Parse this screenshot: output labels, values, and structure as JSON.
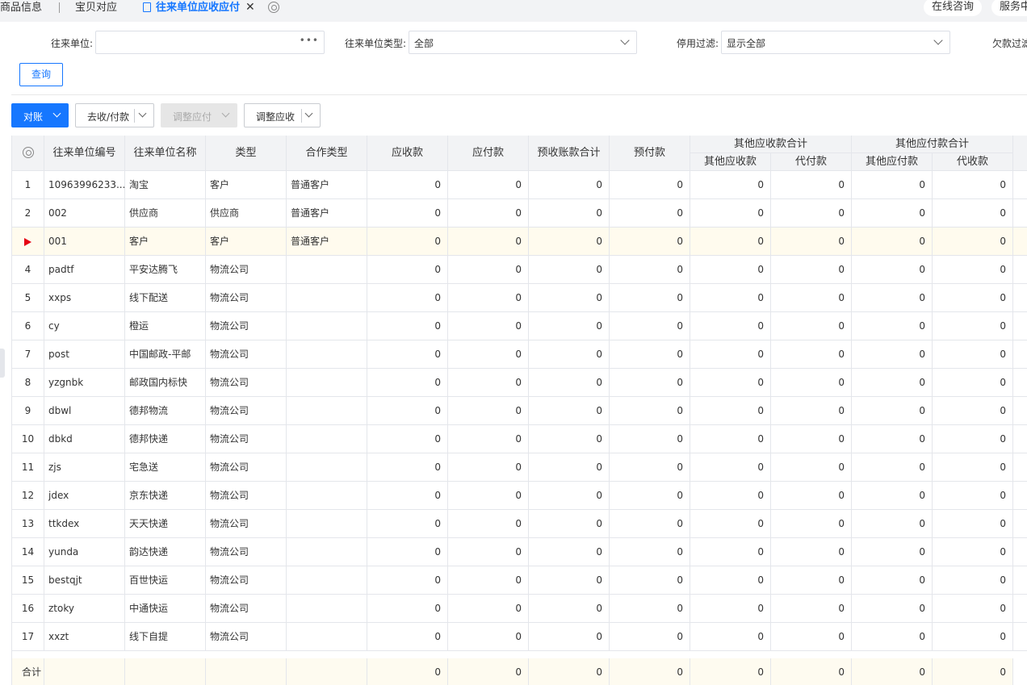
{
  "tabs": {
    "t1": "商品信息",
    "t2": "宝贝对应",
    "t3": "往来单位应收应付",
    "online": "在线咨询",
    "service": "服务中"
  },
  "filters": {
    "unit_label": "往来单位:",
    "unit_value": "",
    "type_label": "往来单位类型:",
    "type_value": "全部",
    "stop_label": "停用过滤:",
    "stop_value": "显示全部",
    "debt_label": "欠款过滤"
  },
  "query_label": "查询",
  "toolbar": {
    "reconcile": "对账",
    "collect_pay": "去收/付款",
    "adjust_payable": "调整应付",
    "adjust_receivable": "调整应收"
  },
  "headers": {
    "code": "往来单位编号",
    "name": "往来单位名称",
    "type": "类型",
    "coop": "合作类型",
    "receivable": "应收款",
    "payable": "应付款",
    "pre_recv": "预收账款合计",
    "prepay": "预付款",
    "other_recv_group": "其他应收款合计",
    "other_recv": "其他应收款",
    "agent_pay": "代付款",
    "other_pay_group": "其他应付款合计",
    "other_pay": "其他应付款",
    "agent_recv": "代收款"
  },
  "rows": [
    {
      "idx": "1",
      "code": "10963996233...",
      "name": "淘宝",
      "type": "客户",
      "coop": "普通客户",
      "v": [
        "0",
        "0",
        "0",
        "0",
        "0",
        "0",
        "0",
        "0"
      ]
    },
    {
      "idx": "2",
      "code": "002",
      "name": "供应商",
      "type": "供应商",
      "coop": "普通客户",
      "v": [
        "0",
        "0",
        "0",
        "0",
        "0",
        "0",
        "0",
        "0"
      ]
    },
    {
      "idx": "",
      "code": "001",
      "name": "客户",
      "type": "客户",
      "coop": "普通客户",
      "v": [
        "0",
        "0",
        "0",
        "0",
        "0",
        "0",
        "0",
        "0"
      ]
    },
    {
      "idx": "4",
      "code": "padtf",
      "name": "平安达腾飞",
      "type": "物流公司",
      "coop": "",
      "v": [
        "0",
        "0",
        "0",
        "0",
        "0",
        "0",
        "0",
        "0"
      ]
    },
    {
      "idx": "5",
      "code": "xxps",
      "name": "线下配送",
      "type": "物流公司",
      "coop": "",
      "v": [
        "0",
        "0",
        "0",
        "0",
        "0",
        "0",
        "0",
        "0"
      ]
    },
    {
      "idx": "6",
      "code": "cy",
      "name": "橙运",
      "type": "物流公司",
      "coop": "",
      "v": [
        "0",
        "0",
        "0",
        "0",
        "0",
        "0",
        "0",
        "0"
      ]
    },
    {
      "idx": "7",
      "code": "post",
      "name": "中国邮政-平邮",
      "type": "物流公司",
      "coop": "",
      "v": [
        "0",
        "0",
        "0",
        "0",
        "0",
        "0",
        "0",
        "0"
      ]
    },
    {
      "idx": "8",
      "code": "yzgnbk",
      "name": "邮政国内标快",
      "type": "物流公司",
      "coop": "",
      "v": [
        "0",
        "0",
        "0",
        "0",
        "0",
        "0",
        "0",
        "0"
      ]
    },
    {
      "idx": "9",
      "code": "dbwl",
      "name": "德邦物流",
      "type": "物流公司",
      "coop": "",
      "v": [
        "0",
        "0",
        "0",
        "0",
        "0",
        "0",
        "0",
        "0"
      ]
    },
    {
      "idx": "10",
      "code": "dbkd",
      "name": "德邦快递",
      "type": "物流公司",
      "coop": "",
      "v": [
        "0",
        "0",
        "0",
        "0",
        "0",
        "0",
        "0",
        "0"
      ]
    },
    {
      "idx": "11",
      "code": "zjs",
      "name": "宅急送",
      "type": "物流公司",
      "coop": "",
      "v": [
        "0",
        "0",
        "0",
        "0",
        "0",
        "0",
        "0",
        "0"
      ]
    },
    {
      "idx": "12",
      "code": "jdex",
      "name": "京东快递",
      "type": "物流公司",
      "coop": "",
      "v": [
        "0",
        "0",
        "0",
        "0",
        "0",
        "0",
        "0",
        "0"
      ]
    },
    {
      "idx": "13",
      "code": "ttkdex",
      "name": "天天快递",
      "type": "物流公司",
      "coop": "",
      "v": [
        "0",
        "0",
        "0",
        "0",
        "0",
        "0",
        "0",
        "0"
      ]
    },
    {
      "idx": "14",
      "code": "yunda",
      "name": "韵达快递",
      "type": "物流公司",
      "coop": "",
      "v": [
        "0",
        "0",
        "0",
        "0",
        "0",
        "0",
        "0",
        "0"
      ]
    },
    {
      "idx": "15",
      "code": "bestqjt",
      "name": "百世快运",
      "type": "物流公司",
      "coop": "",
      "v": [
        "0",
        "0",
        "0",
        "0",
        "0",
        "0",
        "0",
        "0"
      ]
    },
    {
      "idx": "16",
      "code": "ztoky",
      "name": "中通快运",
      "type": "物流公司",
      "coop": "",
      "v": [
        "0",
        "0",
        "0",
        "0",
        "0",
        "0",
        "0",
        "0"
      ]
    },
    {
      "idx": "17",
      "code": "xxzt",
      "name": "线下自提",
      "type": "物流公司",
      "coop": "",
      "v": [
        "0",
        "0",
        "0",
        "0",
        "0",
        "0",
        "0",
        "0"
      ]
    }
  ],
  "total": {
    "label": "合计",
    "v": [
      "0",
      "0",
      "0",
      "0",
      "0",
      "0",
      "0",
      "0"
    ]
  },
  "colors": {
    "accent": "#1677ff",
    "selected_row": "#fffbee",
    "selected_marker": "#e60012"
  }
}
